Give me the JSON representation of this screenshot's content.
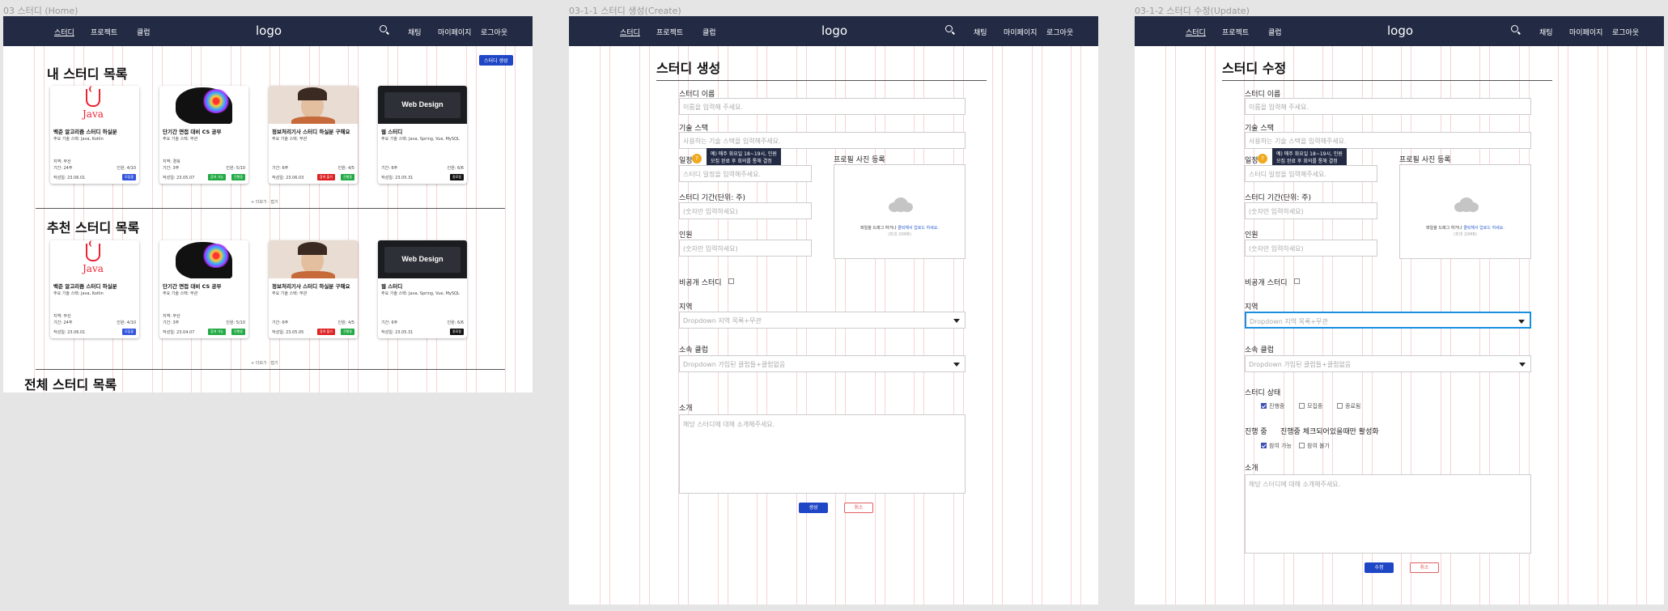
{
  "frames": [
    {
      "label": "03 스터디 (Home)"
    },
    {
      "label": "03-1-1 스터디 생성(Create)"
    },
    {
      "label": "03-1-2 스터디 수정(Update)"
    }
  ],
  "nav": {
    "study": "스터디",
    "project": "프로젝트",
    "club": "클럽",
    "logo": "logo",
    "chat": "채팅",
    "mypage": "마이페이지",
    "logout": "로그아웃"
  },
  "home": {
    "create_button": "스터디 생성",
    "my_title": "내 스터디 목록",
    "rec_title": "추천 스터디 목록",
    "all_title": "전체 스터디 목록",
    "more_label": "+ 더보기 · 접기",
    "my_cards": [
      {
        "img": "java",
        "title": "백준 알고리즘 스터디 하실분",
        "stack": "주요 기술 스택: Java, Kotlin",
        "l1": "지역: 부산",
        "l2": "기간: 24주",
        "l3": "작성일: 23.06.01",
        "right": "인원: 4/10",
        "tags": [
          {
            "t": "모집중",
            "c": "#3355dd"
          }
        ]
      },
      {
        "img": "brain",
        "title": "단기간 면접 대비 CS 공부",
        "stack": "주요 기술 스택: 무관",
        "l1": "지역: 경북",
        "l2": "기간: 3주",
        "l3": "작성일: 23.05.07",
        "right": "인원: 5/10",
        "tags": [
          {
            "t": "참여 가능",
            "c": "#22aa44"
          },
          {
            "t": "진행중",
            "c": "#22aa44"
          }
        ]
      },
      {
        "img": "person",
        "title": "정보처리기사 스터디 하실분 구해요",
        "stack": "주요 기술 스택: 무관",
        "l1": "",
        "l2": "기간: 6주",
        "l3": "작성일: 23.06.03",
        "right": "인원: 4/5",
        "tags": [
          {
            "t": "참여 불가",
            "c": "#dd2222"
          },
          {
            "t": "진행중",
            "c": "#22aa44"
          }
        ]
      },
      {
        "img": "web",
        "title": "웹 스터디",
        "stack": "주요 기술 스택: Java, Spring, Vue, MySQL",
        "l1": "",
        "l2": "기간: 6주",
        "l3": "작성일: 23.05.31",
        "right": "인원: 6/6",
        "tags": [
          {
            "t": "종료됨",
            "c": "#111111"
          }
        ]
      }
    ],
    "rec_cards": [
      {
        "img": "java",
        "title": "백준 알고리즘 스터디 하실분",
        "stack": "주요 기술 스택: Java, Kotlin",
        "l1": "지역: 부산",
        "l2": "기간: 24주",
        "l3": "작성일: 23.06.01",
        "right": "인원: 4/10",
        "tags": [
          {
            "t": "모집중",
            "c": "#3355dd"
          }
        ]
      },
      {
        "img": "brain",
        "title": "단기간 면접 대비 CS 공부",
        "stack": "주요 기술 스택: 무관",
        "l1": "지역: 부산",
        "l2": "기간: 3주",
        "l3": "작성일: 23.04.07",
        "right": "인원: 5/10",
        "tags": [
          {
            "t": "참여 가능",
            "c": "#22aa44"
          },
          {
            "t": "진행중",
            "c": "#22aa44"
          }
        ]
      },
      {
        "img": "person",
        "title": "정보처리기사 스터디 하실분 구해요",
        "stack": "주요 기술 스택: 무관",
        "l1": "",
        "l2": "기간: 6주",
        "l3": "작성일: 23.05.05",
        "right": "인원: 4/5",
        "tags": [
          {
            "t": "참여 불가",
            "c": "#dd2222"
          },
          {
            "t": "진행중",
            "c": "#22aa44"
          }
        ]
      },
      {
        "img": "web",
        "title": "웹 스터디",
        "stack": "주요 기술 스택: Java, Spring, Vue, MySQL",
        "l1": "",
        "l2": "기간: 6주",
        "l3": "작성일: 23.05.31",
        "right": "인원: 6/6",
        "tags": [
          {
            "t": "종료됨",
            "c": "#111111"
          }
        ]
      }
    ]
  },
  "form": {
    "create_title": "스터디 생성",
    "update_title": "스터디 수정",
    "name_label": "스터디 이름",
    "name_ph": "이름을 입력해 주세요.",
    "stack_label": "기술 스택",
    "stack_ph": "사용하는 기술 스택을 입력해주세요.",
    "schedule_label": "일정",
    "schedule_ph": "스터디 일정을 입력해주세요.",
    "tooltip_l1": "예) 매주 화요일 18~19시, 인원",
    "tooltip_l2": "모집 완료 후 회의를 통해 결정",
    "period_label": "스터디 기간(단위: 주)",
    "period_ph": "(숫자만 입력하세요)",
    "people_label": "인원",
    "people_ph": "(숫자만 입력하세요)",
    "photo_label": "프로필 사진 등록",
    "upload_text_a": "파일을 드래그 하거나 ",
    "upload_link": "클릭해서 업로드 하세요.",
    "upload_sub": "(최대 20MB)",
    "private_label": "비공개 스터디",
    "region_label": "지역",
    "region_ph": "Dropdown 지역 목록+무관",
    "club_label": "소속 클럽",
    "club_ph": "Dropdown 가입된 클럽들+클럽없음",
    "intro_label": "소개",
    "intro_ph": "해당 스터디에 대해 소개해주세요.",
    "create_btn": "생성",
    "cancel_btn": "취소",
    "update_btn": "수정",
    "status_label": "스터디 상태",
    "status_opts": [
      "진행중",
      "모집중",
      "종료됨"
    ],
    "progress_label": "진행 중",
    "progress_note": "진행중 체크되어있을때만 활성화",
    "progress_opts": [
      "참여 가능",
      "참여 불가"
    ]
  }
}
